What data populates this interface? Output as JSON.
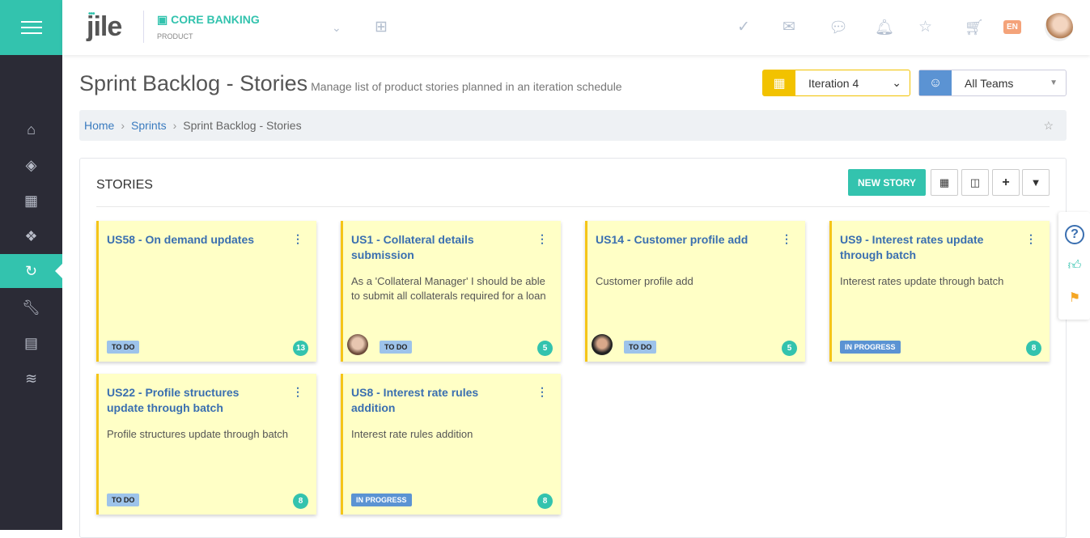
{
  "header": {
    "logo": "jile",
    "product": "CORE BANKING",
    "product_sub": "PRODUCT",
    "lang": "EN"
  },
  "page": {
    "title": "Sprint Backlog - Stories",
    "subtitle": "Manage list of product stories planned in an iteration schedule"
  },
  "filters": {
    "iteration": "Iteration 4",
    "team": "All Teams"
  },
  "breadcrumb": [
    "Home",
    "Sprints",
    "Sprint Backlog - Stories"
  ],
  "panel": {
    "title": "STORIES",
    "new_story": "NEW STORY"
  },
  "colors": {
    "accent": "#33c3ae",
    "card": "#ffffc6",
    "sidebar": "#2b2b36"
  },
  "cards": [
    {
      "title": "US58 - On demand updates",
      "desc": "",
      "status": "TO DO",
      "points": "13"
    },
    {
      "title": "US1 - Collateral details submission",
      "desc": "As a 'Collateral Manager' I should be able to submit all collaterals required for a loan",
      "status": "TO DO",
      "points": "5"
    },
    {
      "title": "US14 - Customer profile add",
      "desc": "Customer profile add",
      "status": "TO DO",
      "points": "5"
    },
    {
      "title": "US9 - Interest rates update through batch",
      "desc": "Interest rates update through batch",
      "status": "IN PROGRESS",
      "points": "8"
    },
    {
      "title": "US22 - Profile structures update through batch",
      "desc": "Profile structures update through batch",
      "status": "TO DO",
      "points": "8"
    },
    {
      "title": "US8 - Interest rate rules addition",
      "desc": "Interest rate rules addition",
      "status": "IN PROGRESS",
      "points": "8"
    }
  ]
}
